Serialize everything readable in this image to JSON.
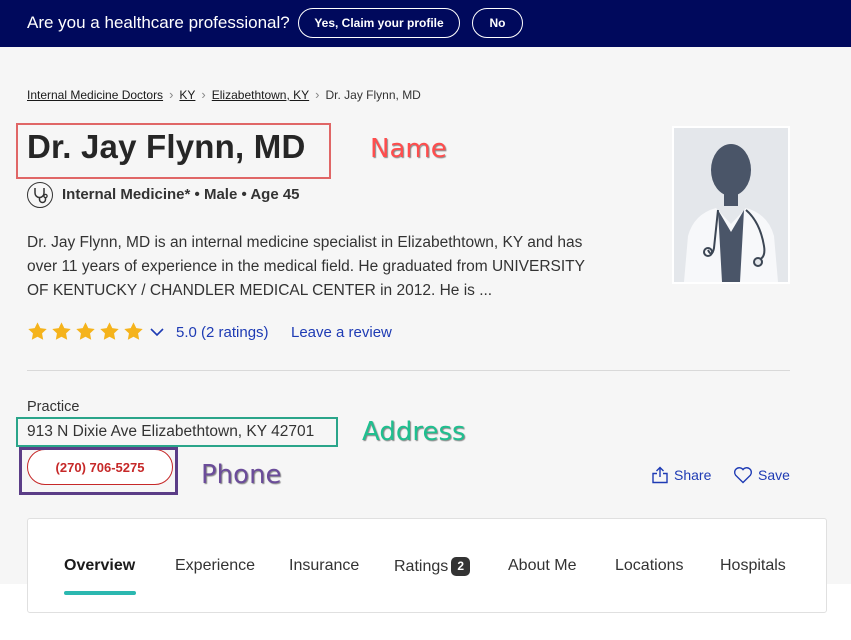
{
  "banner": {
    "question": "Are you a healthcare professional?",
    "claim_label": "Yes, Claim your profile",
    "no_label": "No"
  },
  "breadcrumb": {
    "items": [
      "Internal Medicine Doctors",
      "KY",
      "Elizabethtown, KY",
      "Dr. Jay Flynn, MD"
    ]
  },
  "doctor": {
    "name": "Dr. Jay Flynn, MD",
    "specialty_line": "Internal Medicine* • Male • Age 45",
    "bio": "Dr. Jay Flynn, MD is an internal medicine specialist in Elizabethtown, KY and has over 11 years of experience in the medical field. He graduated from UNIVERSITY OF KENTUCKY / CHANDLER MEDICAL CENTER in 2012. He is ...",
    "rating_stars": 5,
    "rating_text": "5.0 (2 ratings)",
    "review_link": "Leave a review"
  },
  "practice": {
    "label": "Practice",
    "address": "913 N Dixie Ave Elizabethtown, KY 42701",
    "phone": "(270) 706-5275"
  },
  "actions": {
    "share_label": "Share",
    "save_label": "Save"
  },
  "tabs": [
    {
      "label": "Overview"
    },
    {
      "label": "Experience"
    },
    {
      "label": "Insurance"
    },
    {
      "label": "Ratings",
      "badge": "2"
    },
    {
      "label": "About Me"
    },
    {
      "label": "Locations"
    },
    {
      "label": "Hospitals"
    }
  ],
  "annotations": {
    "name": "Name",
    "address": "Address",
    "phone": "Phone"
  },
  "colors": {
    "banner_bg": "#00095c",
    "link": "#1e3bb4",
    "phone": "#c62828",
    "star": "#f5b31b",
    "tab_active": "#2bb8b0"
  },
  "icons": [
    "stethoscope-icon",
    "star-icon",
    "chevron-down-icon",
    "share-icon",
    "heart-icon",
    "avatar-silhouette"
  ]
}
